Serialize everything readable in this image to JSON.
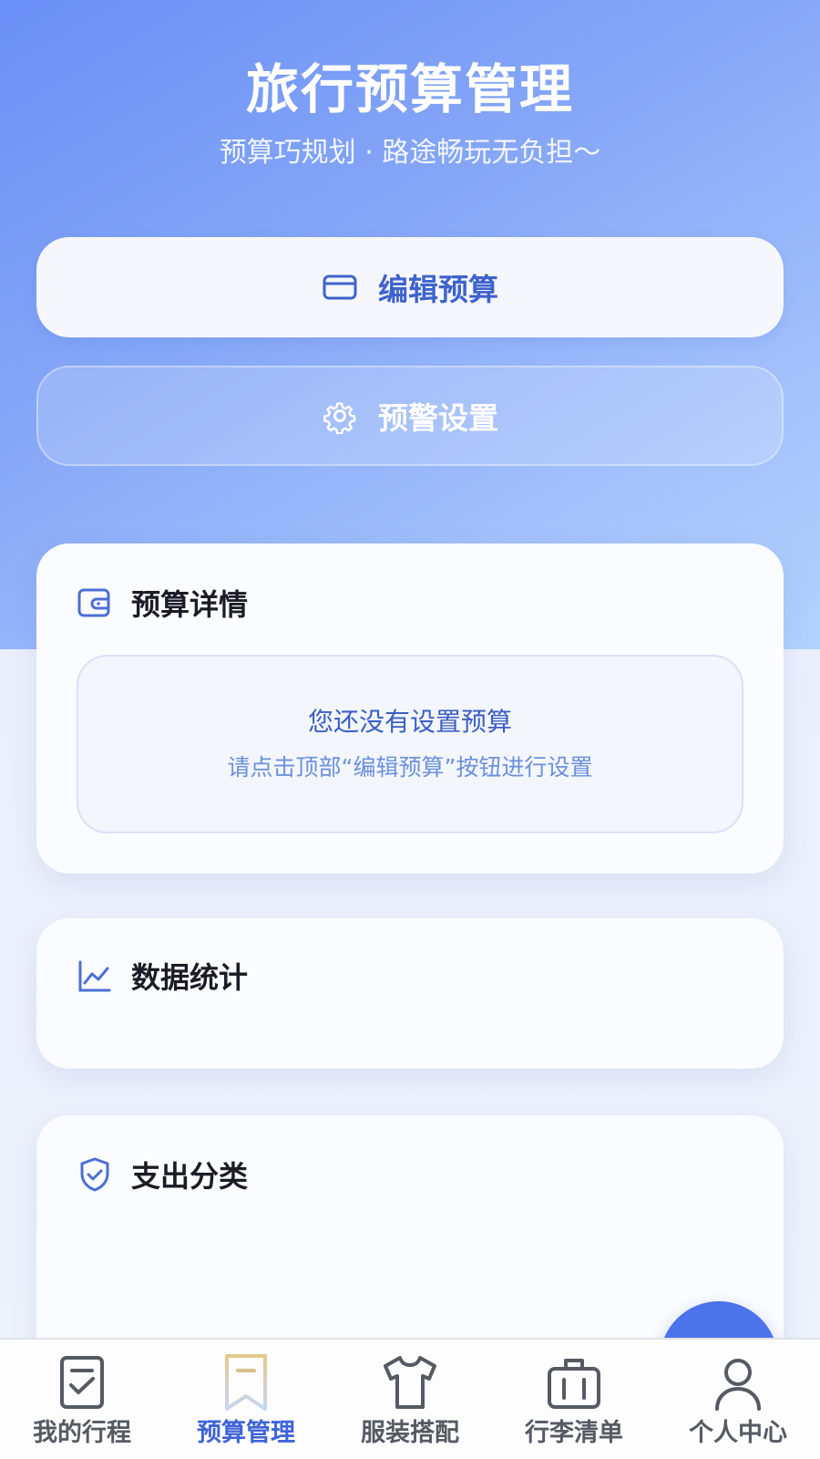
{
  "header": {
    "title": "旅行预算管理",
    "subtitle": "预算巧规划 · 路途畅玩无负担～"
  },
  "actions": {
    "edit_budget": "编辑预算",
    "alert_settings": "预警设置"
  },
  "budget_detail": {
    "title": "预算详情",
    "empty_title": "您还没有设置预算",
    "empty_hint": "请点击顶部“编辑预算”按钮进行设置"
  },
  "statistics": {
    "title": "数据统计"
  },
  "expense": {
    "title": "支出分类"
  },
  "tabbar": {
    "tabs": [
      {
        "label": "我的行程",
        "icon": "itinerary-checklist-icon",
        "active": false
      },
      {
        "label": "预算管理",
        "icon": "bookmark-icon",
        "active": true
      },
      {
        "label": "服装搭配",
        "icon": "tshirt-icon",
        "active": false
      },
      {
        "label": "行李清单",
        "icon": "luggage-icon",
        "active": false
      },
      {
        "label": "个人中心",
        "icon": "person-icon",
        "active": false
      }
    ]
  },
  "colors": {
    "accent": "#3f64d8",
    "hero_start": "#6a8ff5",
    "hero_end": "#b2d2fd",
    "active_icon": "#d9c08a"
  }
}
